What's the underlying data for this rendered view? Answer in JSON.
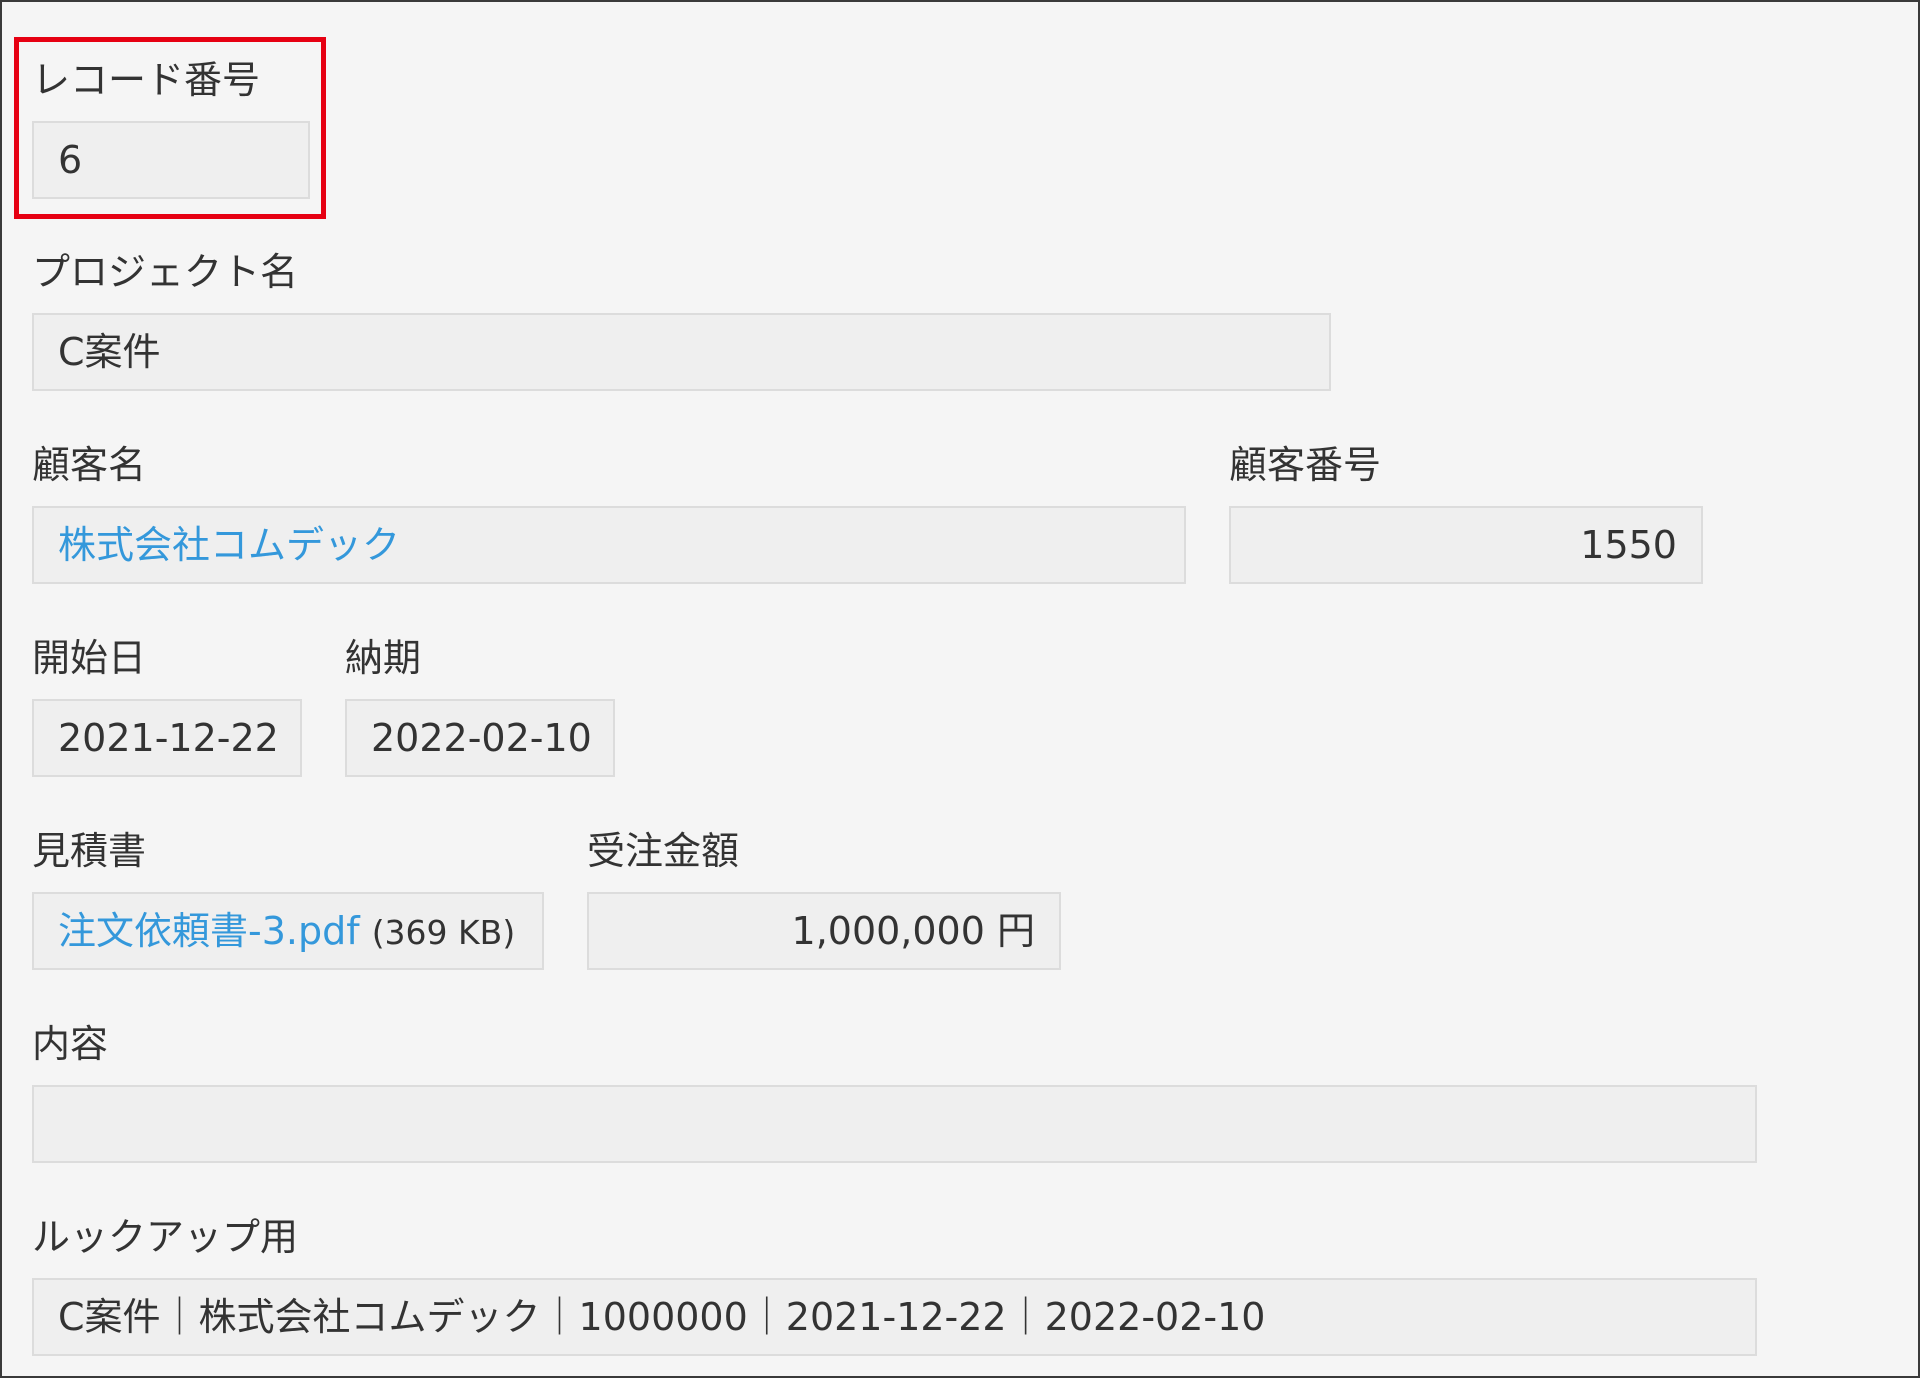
{
  "record_number": {
    "label": "レコード番号",
    "value": "6"
  },
  "project_name": {
    "label": "プロジェクト名",
    "value": "C案件"
  },
  "customer_name": {
    "label": "顧客名",
    "value": "株式会社コムデック"
  },
  "customer_number": {
    "label": "顧客番号",
    "value": "1550"
  },
  "start_date": {
    "label": "開始日",
    "value": "2021-12-22"
  },
  "due_date": {
    "label": "納期",
    "value": "2022-02-10"
  },
  "quote": {
    "label": "見積書",
    "file_name": "注文依頼書-3.pdf",
    "file_size": "(369 KB)"
  },
  "order_amount": {
    "label": "受注金額",
    "value": "1,000,000 円"
  },
  "content": {
    "label": "内容",
    "value": ""
  },
  "lookup": {
    "label": "ルックアップ用",
    "value": "C案件｜株式会社コムデック｜1000000｜2021-12-22｜2022-02-10"
  },
  "colors": {
    "background": "#f5f5f5",
    "field_background": "#efefef",
    "field_border": "#dcdcdc",
    "link": "#3498db",
    "highlight": "#e60012",
    "frame_border": "#3a3a3a"
  }
}
